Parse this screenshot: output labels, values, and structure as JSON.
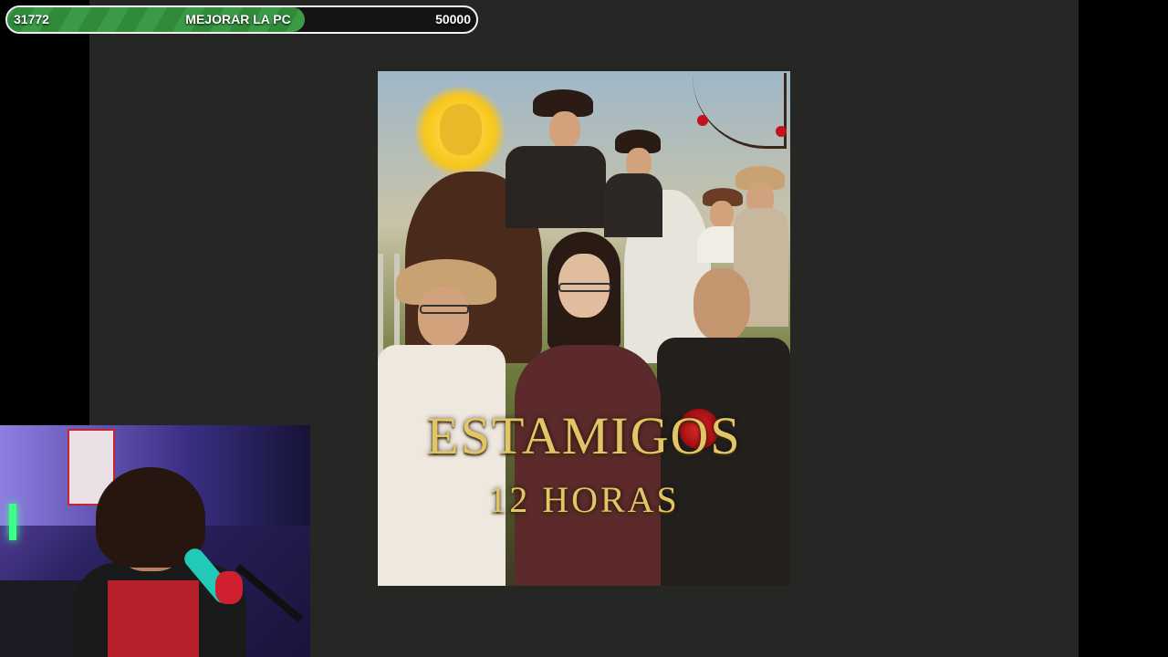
{
  "goal": {
    "current": "31772",
    "label": "MEJORAR LA PC",
    "target": "50000",
    "progress": 0.635
  },
  "poster": {
    "title": "ESTAMIGOS",
    "subtitle": "12 HORAS"
  },
  "colors": {
    "goal_fill": "#3a9a45",
    "background": "#262624",
    "poster_title": "#e3c466"
  }
}
